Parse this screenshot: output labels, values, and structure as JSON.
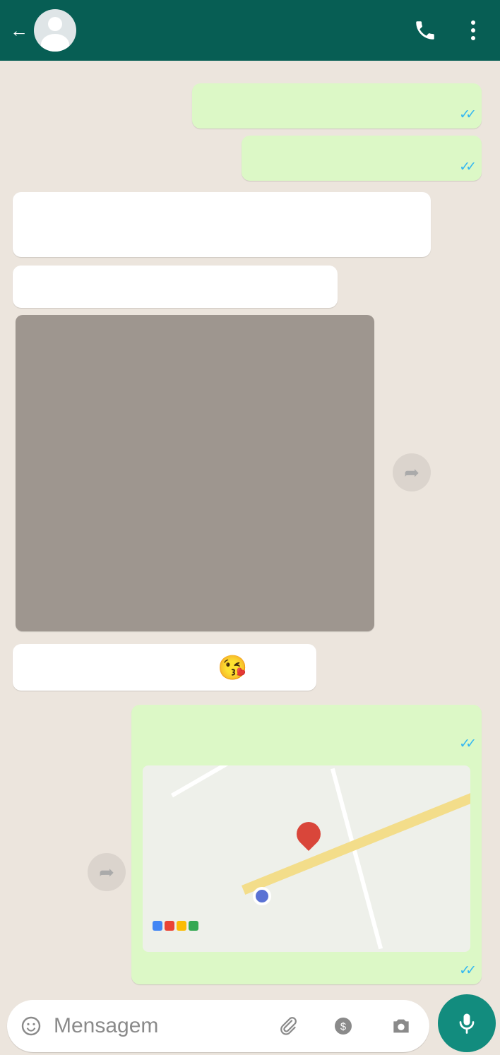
{
  "header": {
    "back_icon": "arrow-left-icon",
    "contact_name": "",
    "call_icon": "phone-icon",
    "menu_icon": "more-vertical-icon",
    "color": "#075e54"
  },
  "chat": {
    "background": "#ece5dd",
    "outgoing_color": "#dcf8c6",
    "incoming_color": "#ffffff",
    "messages": [
      {
        "direction": "out",
        "text": "",
        "time": "",
        "status": "read"
      },
      {
        "direction": "out",
        "text": "",
        "time": "",
        "status": "read"
      },
      {
        "direction": "in",
        "text": "",
        "time": ""
      },
      {
        "direction": "in",
        "text": "",
        "time": ""
      },
      {
        "direction": "in",
        "type": "image",
        "content": "withheld"
      },
      {
        "direction": "in",
        "text": "",
        "emoji": "😘",
        "time": ""
      },
      {
        "direction": "out",
        "text": "",
        "time": "",
        "status": "read"
      },
      {
        "direction": "out",
        "type": "location",
        "time": "",
        "status": "read"
      }
    ]
  },
  "composer": {
    "emoji_icon": "smiley-icon",
    "placeholder": "Mensagem",
    "attach_icon": "paperclip-icon",
    "payment_icon": "payment-icon",
    "camera_icon": "camera-icon",
    "mic_icon": "mic-icon",
    "mic_color": "#128c7e"
  }
}
